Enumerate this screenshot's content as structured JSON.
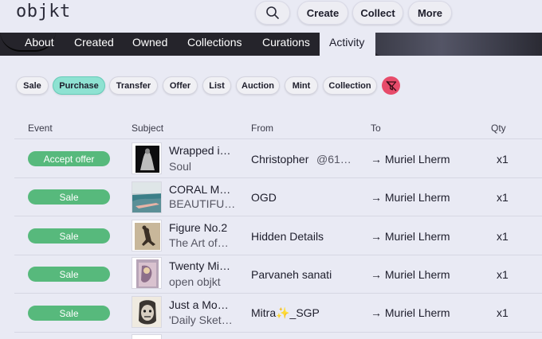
{
  "header": {
    "logo": "objkt",
    "search_icon": "search-icon",
    "buttons": {
      "create": "Create",
      "collect": "Collect",
      "more": "More"
    }
  },
  "tabs": [
    "About",
    "Created",
    "Owned",
    "Collections",
    "Curations",
    "Activity"
  ],
  "active_tab": "Activity",
  "filters": [
    "Sale",
    "Purchase",
    "Transfer",
    "Offer",
    "List",
    "Auction",
    "Mint",
    "Collection"
  ],
  "selected_filter": "Purchase",
  "filter_icon": "filter-clear-icon",
  "colors": {
    "accent_teal": "#8ee2d2",
    "badge_green": "#57b97c",
    "filter_pink": "#e74b6a"
  },
  "table": {
    "columns": [
      "Event",
      "Subject",
      "From",
      "To",
      "Qty"
    ],
    "rows": [
      {
        "event": "Accept offer",
        "title": "Wrapped i…",
        "subtitle": "Soul",
        "from": "Christopher",
        "from_extra": "@61…",
        "to": "Muriel Lherm",
        "qty": "x1"
      },
      {
        "event": "Sale",
        "title": "CORAL M…",
        "subtitle": "BEAUTIFU…",
        "from": "OGD",
        "from_extra": "",
        "to": "Muriel Lherm",
        "qty": "x1"
      },
      {
        "event": "Sale",
        "title": "Figure No.2",
        "subtitle": "The Art of…",
        "from": "Hidden Details",
        "from_extra": "",
        "to": "Muriel Lherm",
        "qty": "x1"
      },
      {
        "event": "Sale",
        "title": "Twenty Mi…",
        "subtitle": "open objkt",
        "from": "Parvaneh sanati",
        "from_extra": "",
        "to": "Muriel Lherm",
        "qty": "x1"
      },
      {
        "event": "Sale",
        "title": "Just a Mo…",
        "subtitle": "'Daily Sket…",
        "from": "Mitra✨_SGP",
        "from_extra": "",
        "to": "Muriel Lherm",
        "qty": "x1"
      }
    ],
    "arrow": "→"
  }
}
